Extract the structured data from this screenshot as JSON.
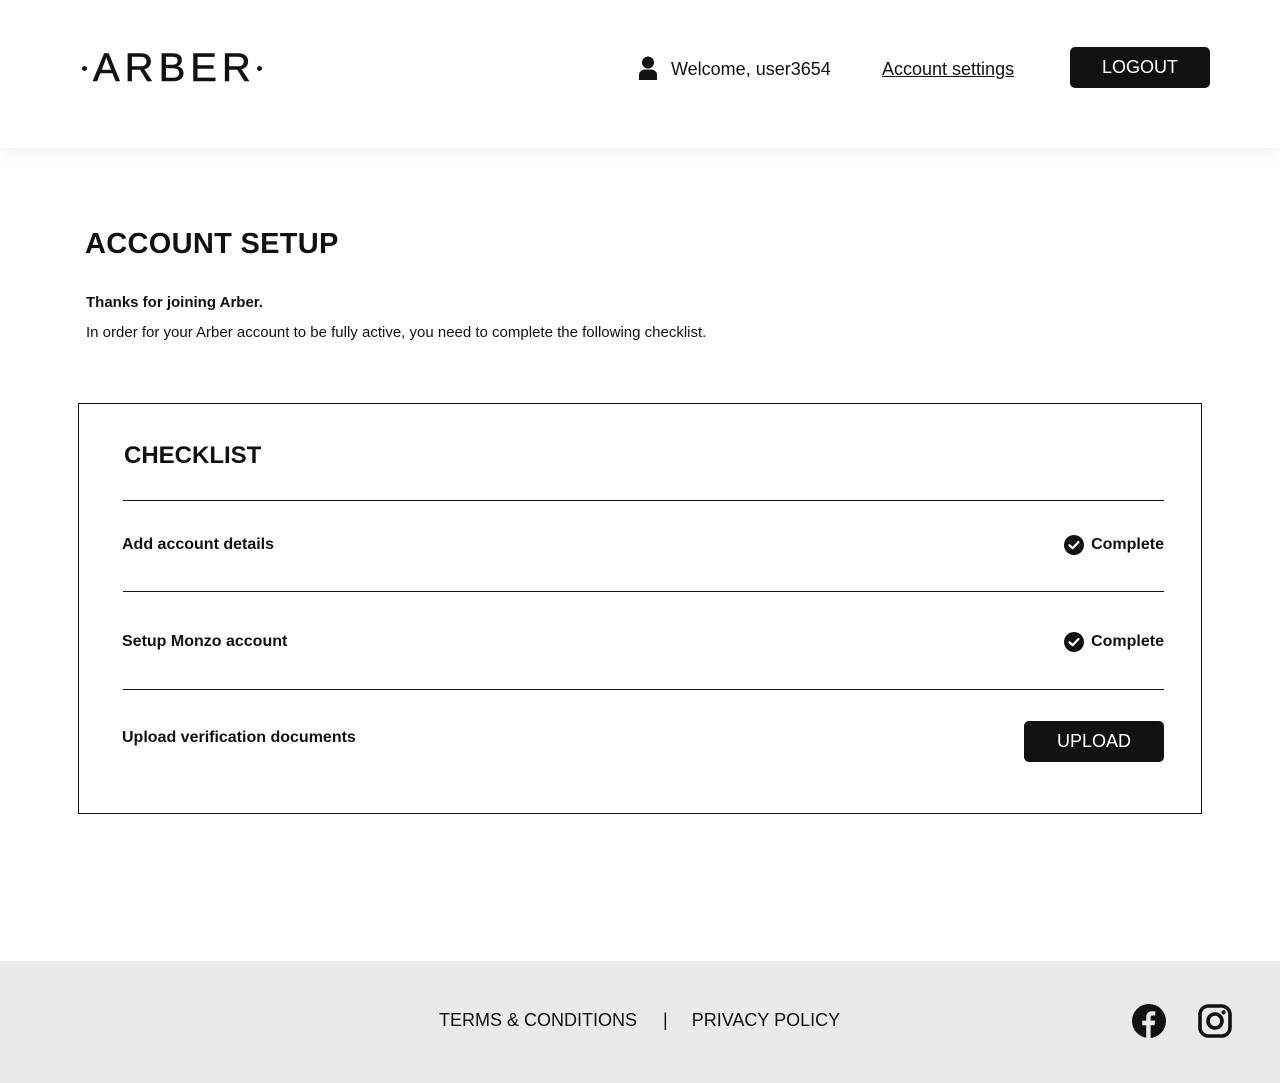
{
  "header": {
    "logo_text": "ARBER",
    "welcome_text": "Welcome, user3654",
    "account_settings_label": "Account settings",
    "logout_label": "LOGOUT"
  },
  "main": {
    "title": "ACCOUNT SETUP",
    "intro_bold": "Thanks for joining Arber.",
    "intro_text": "In order for your Arber account to be fully active, you need to complete the following checklist."
  },
  "checklist": {
    "title": "CHECKLIST",
    "items": [
      {
        "label": "Add account details",
        "status": "Complete"
      },
      {
        "label": "Setup Monzo account",
        "status": "Complete"
      },
      {
        "label": "Upload verification documents",
        "action_label": "UPLOAD"
      }
    ]
  },
  "footer": {
    "terms_label": "TERMS & CONDITIONS",
    "separator": "|",
    "privacy_label": "PRIVACY POLICY",
    "social": [
      "facebook-icon",
      "instagram-icon"
    ]
  },
  "colors": {
    "primary": "#111111",
    "background": "#ffffff",
    "footer_background": "#eaeaea"
  }
}
